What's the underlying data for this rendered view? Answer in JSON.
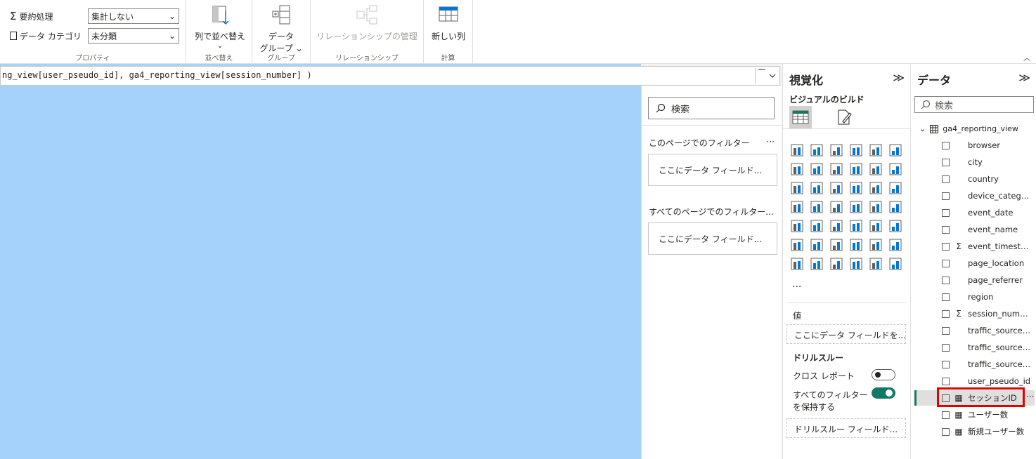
{
  "ribbon": {
    "properties": {
      "summarize_label": "要約処理",
      "summarize_value": "集計しない",
      "category_label": "データ カテゴリ",
      "category_value": "未分類",
      "group_label": "プロパティ"
    },
    "sort": {
      "button_label": "列で並べ替え",
      "group_label": "並べ替え"
    },
    "groups": {
      "button_label_line1": "データ",
      "button_label_line2": "グループ",
      "group_label": "グループ"
    },
    "relationships": {
      "button_label": "リレーションシップの管理",
      "group_label": "リレーションシップ"
    },
    "calc": {
      "button_label": "新しい列",
      "group_label": "計算"
    }
  },
  "formula_bar": {
    "text": "ng_view[user_pseudo_id], ga4_reporting_view[session_number] )"
  },
  "filters": {
    "search_placeholder": "検索",
    "page_filters_title": "このページでのフィルター",
    "page_filters_drop": "ここにデータ フィールド...",
    "all_filters_title": "すべてのページでのフィルター...",
    "all_filters_drop": "ここにデータ フィールド...",
    "more": "···"
  },
  "visualizations": {
    "title": "視覚化",
    "collapse": "≫",
    "build_label": "ビジュアルのビルド",
    "more": "···",
    "values_label": "値",
    "values_drop": "ここにデータ フィールドを...",
    "drillthrough_label": "ドリルスルー",
    "cross_report_label": "クロス レポート",
    "keep_filters_label_1": "すべてのフィルター",
    "keep_filters_label_2": "を保持する",
    "drillthrough_drop": "ドリルスルー フィールド..."
  },
  "data": {
    "title": "データ",
    "collapse": "≫",
    "search_placeholder": "検索",
    "table_name": "ga4_reporting_view",
    "fields": [
      {
        "name": "browser",
        "icon": ""
      },
      {
        "name": "city",
        "icon": ""
      },
      {
        "name": "country",
        "icon": ""
      },
      {
        "name": "device_category",
        "icon": ""
      },
      {
        "name": "event_date",
        "icon": ""
      },
      {
        "name": "event_name",
        "icon": ""
      },
      {
        "name": "event_timestamp",
        "icon": "Σ"
      },
      {
        "name": "page_location",
        "icon": ""
      },
      {
        "name": "page_referrer",
        "icon": ""
      },
      {
        "name": "region",
        "icon": ""
      },
      {
        "name": "session_number",
        "icon": "Σ"
      },
      {
        "name": "traffic_source_...",
        "icon": ""
      },
      {
        "name": "traffic_source_n...",
        "icon": ""
      },
      {
        "name": "traffic_source_s...",
        "icon": ""
      },
      {
        "name": "user_pseudo_id",
        "icon": ""
      },
      {
        "name": "セッションID",
        "icon": "▦"
      },
      {
        "name": "ユーザー数",
        "icon": "▦"
      },
      {
        "name": "新規ユーザー数",
        "icon": "▦"
      }
    ],
    "row_more": "···"
  },
  "colors": {
    "accent": "#117865",
    "canvas": "#a5d2fb",
    "highlight": "#e00000"
  }
}
